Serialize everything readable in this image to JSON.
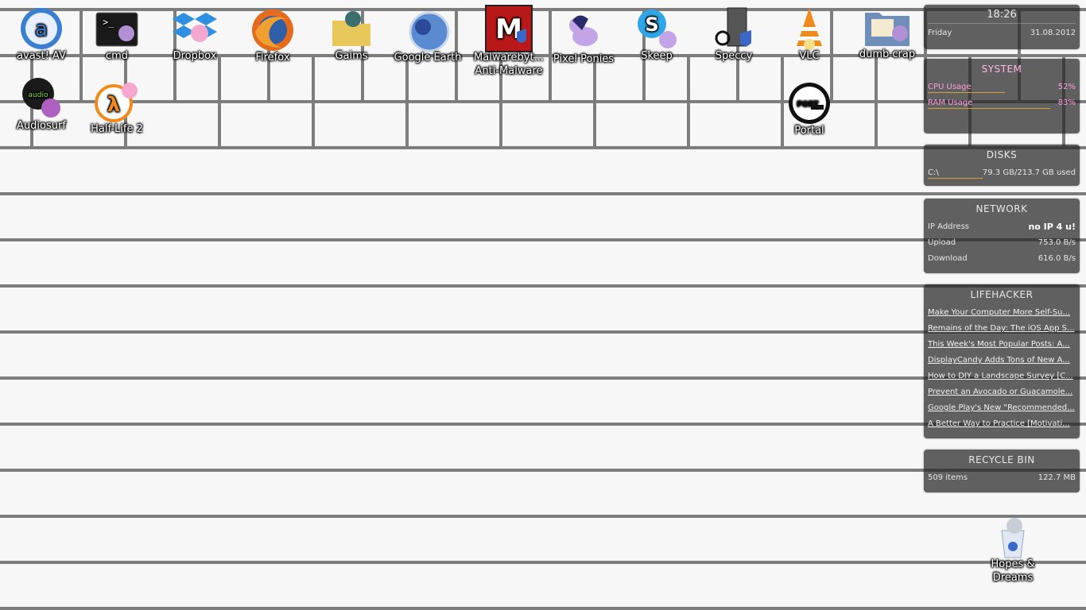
{
  "desktop": {
    "icons": [
      {
        "label": "avast! AV"
      },
      {
        "label": "cmd"
      },
      {
        "label": "Dropbox"
      },
      {
        "label": "Firefox"
      },
      {
        "label": "Gaims"
      },
      {
        "label": "Google Earth"
      },
      {
        "label": "Malwarebyt...\nAnti-Malware"
      },
      {
        "label": "Pixel Ponies"
      },
      {
        "label": "Skeep"
      },
      {
        "label": "Speccy"
      },
      {
        "label": "VLC"
      },
      {
        "label": "dumb crap"
      },
      {
        "label": "Audiosurf"
      },
      {
        "label": "Half-Life 2"
      },
      {
        "label": "Portal"
      },
      {
        "label": "Hopes &\nDreams"
      }
    ],
    "icon_names": [
      "avast-icon",
      "cmd-icon",
      "dropbox-icon",
      "firefox-icon",
      "folder-icon",
      "google-earth-icon",
      "malwarebytes-icon",
      "pixel-ponies-icon",
      "skype-icon",
      "speccy-icon",
      "vlc-icon",
      "folder-icon",
      "audiosurf-icon",
      "half-life-2-icon",
      "portal-icon",
      "recycle-bin-icon"
    ]
  },
  "widgets": {
    "clock": {
      "time": "18:26",
      "day": "Friday",
      "date": "31.08.2012"
    },
    "system": {
      "title": "SYSTEM",
      "cpu_label": "CPU Usage",
      "cpu_value": "52%",
      "cpu_fraction": 0.52,
      "ram_label": "RAM Usage",
      "ram_value": "83%",
      "ram_fraction": 0.83
    },
    "disks": {
      "title": "DISKS",
      "drive": "C:\\",
      "usage": "79.3 GB/213.7 GB used",
      "used_fraction": 0.371
    },
    "network": {
      "title": "NETWORK",
      "ip_label": "IP Address",
      "ip_value": "no IP 4 u!",
      "upload_label": "Upload",
      "upload_value": "753.0 B/s",
      "download_label": "Download",
      "download_value": "616.0 B/s"
    },
    "lifehacker": {
      "title": "LIFEHACKER",
      "items": [
        "Make Your Computer More Self-Su...",
        "Remains of the Day: The iOS App S...",
        "This Week's Most Popular Posts: A...",
        "DisplayCandy Adds Tons of New A...",
        "How to DIY a Landscape Survey [C...",
        "Prevent an Avocado or Guacamole...",
        "Google Play's New \"Recommended...",
        "A Better Way to Practice [Motivati..."
      ]
    },
    "recycle": {
      "title": "RECYCLE BIN",
      "items_count": "509 items",
      "size": "122.7 MB"
    }
  },
  "colors": {
    "accent_bar": "#d8a23a",
    "pink_text": "#ff9ee0",
    "widget_bg": "#262626"
  }
}
